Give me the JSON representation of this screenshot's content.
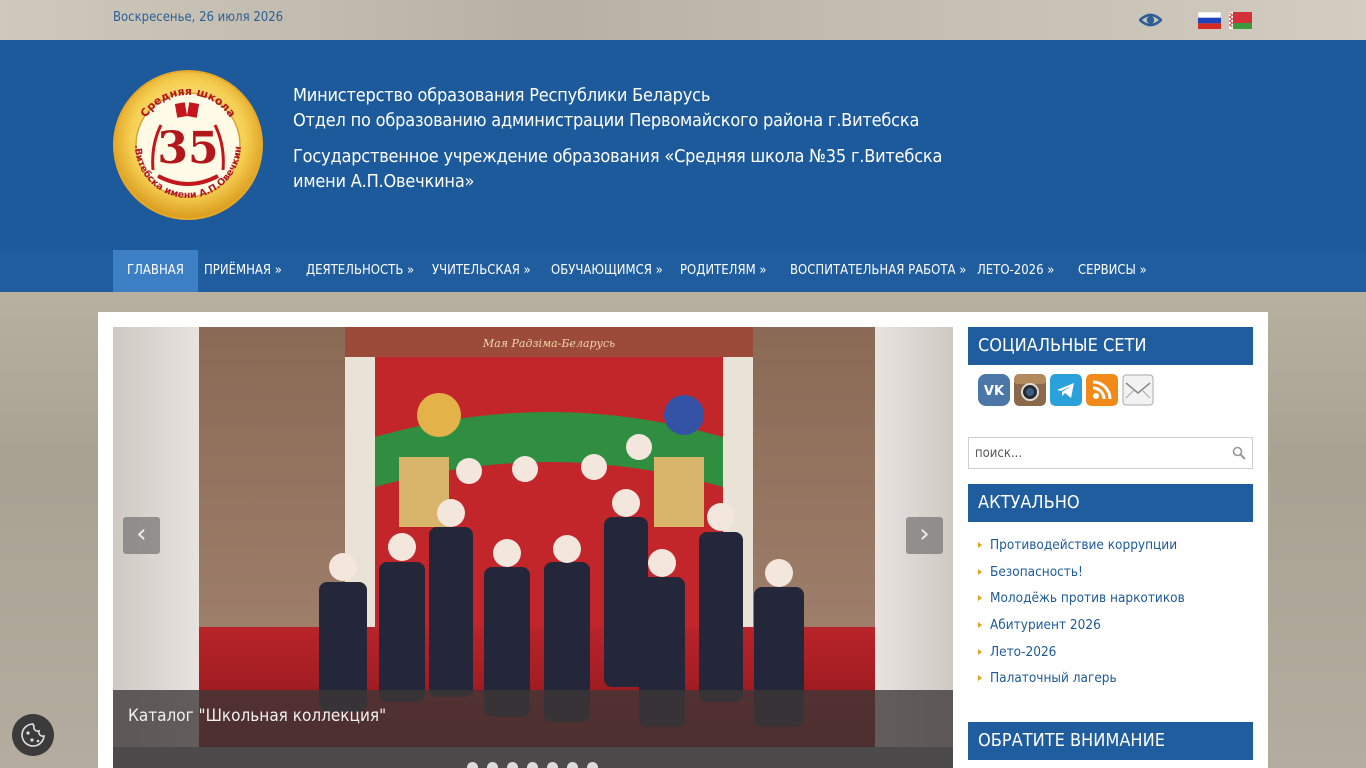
{
  "topbar": {
    "date": "Воскресенье, 26 июля 2026",
    "vision_icon": "eye-icon",
    "languages": [
      {
        "code": "ru",
        "icon": "flag-russia-icon"
      },
      {
        "code": "by",
        "icon": "flag-belarus-icon"
      }
    ]
  },
  "header": {
    "logo_icon": "school-35-emblem-icon",
    "logo_number": "35",
    "logo_ring_text": "Средняя школа",
    "logo_ring_text_bottom": "г.Витебска имени А.П.Овечкина",
    "line1": "Министерство образования Республики Беларусь",
    "line2": "Отдел по образованию администрации Первомайского района г.Витебска",
    "line3": "Государственное учреждение образования «Средняя школа №35 г.Витебска",
    "line4": "имени А.П.Овечкина»"
  },
  "nav": {
    "items": [
      {
        "label": "Главная",
        "active": true
      },
      {
        "label": "Приёмная »"
      },
      {
        "label": "Деятельность »"
      },
      {
        "label": "Учительская »"
      },
      {
        "label": "Обучающимся »"
      },
      {
        "label": "Родителям »"
      },
      {
        "label": "Воспитательная работа »"
      },
      {
        "label": "Лето-2026 »"
      },
      {
        "label": "Сервисы »"
      }
    ]
  },
  "slider": {
    "photo_banner": "Мая Радзіма-Беларусь",
    "caption": "Каталог \"Школьная коллекция\"",
    "prev_icon": "chevron-left-icon",
    "next_icon": "chevron-right-icon",
    "prev_label": "‹",
    "next_label": "›",
    "slide_count": 7,
    "current_slide": 1
  },
  "sidebar": {
    "social_title": "Социальные сети",
    "social_icons": [
      "vk-icon",
      "instagram-icon",
      "telegram-icon",
      "rss-icon",
      "mail-icon"
    ],
    "search_placeholder": "поиск...",
    "search_icon": "search-icon",
    "actual_title": "Актуально",
    "actual_links": [
      "Противодействие коррупции",
      "Безопасность!",
      "Молодёжь против наркотиков",
      "Абитуриент 2026",
      "Лето-2026",
      "Палаточный лагерь"
    ],
    "attention_title": "Обратите внимание"
  },
  "cookie_icon": "cookie-icon",
  "colors": {
    "brand_blue": "#1d5a9b",
    "nav_active": "#3d7fc4",
    "link_blue": "#1e5a96",
    "bullet_orange": "#e3a21a"
  }
}
